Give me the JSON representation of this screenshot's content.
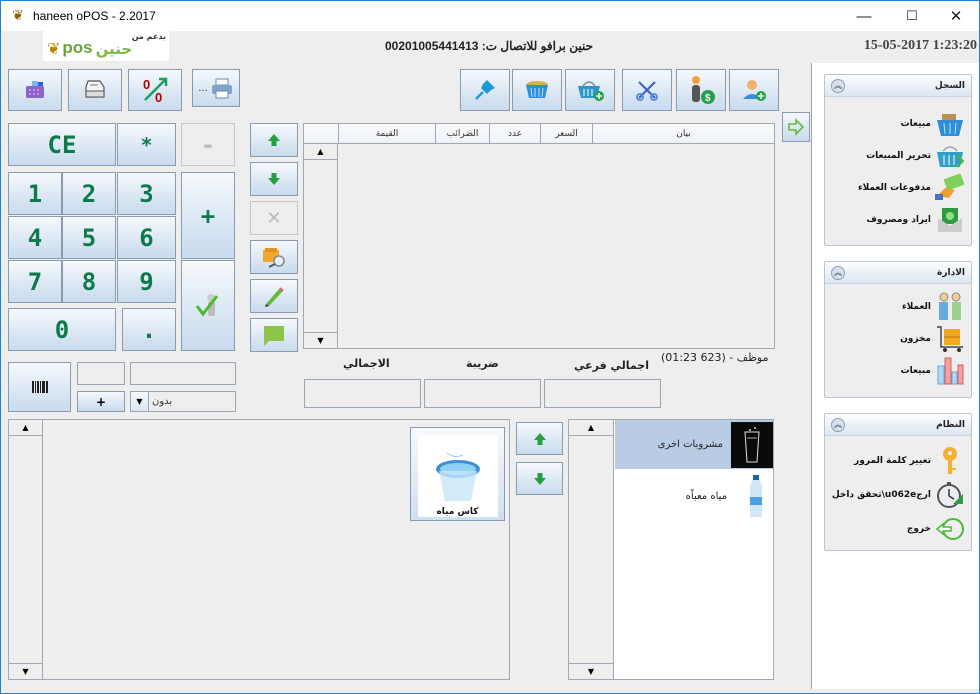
{
  "window": {
    "title": "haneen oPOS - 2.2017",
    "minimize": "—",
    "maximize": "☐",
    "close": "✕"
  },
  "header": {
    "logo_text_latin": "pos",
    "logo_text_arabic": "حنين",
    "logo_sup": "بدعم من",
    "contact": "حنين برافو للاتصال ت: 00201005441413",
    "datetime": "15-05-2017 1:23:20"
  },
  "toolbar_left": [
    {
      "name": "cash-drawer",
      "icon": "cash-register-icon"
    },
    {
      "name": "print-receipt",
      "icon": "printer-icon"
    },
    {
      "name": "discount",
      "icon": "percent-icon"
    },
    {
      "name": "printer-settings",
      "icon": "printer-dots-icon",
      "label": "..."
    }
  ],
  "toolbar_right": [
    {
      "name": "pin",
      "icon": "pin-icon"
    },
    {
      "name": "basket",
      "icon": "basket-icon"
    },
    {
      "name": "add-basket",
      "icon": "basket-add-icon"
    },
    {
      "name": "cut",
      "icon": "scissors-icon"
    },
    {
      "name": "customer-payment",
      "icon": "person-dollar-icon"
    },
    {
      "name": "add-customer",
      "icon": "user-add-icon"
    }
  ],
  "keypad": {
    "ce": "CE",
    "star": "*",
    "minus": "-",
    "plus": "+",
    "dot": ".",
    "zero": "0",
    "digits": [
      "1",
      "2",
      "3",
      "4",
      "5",
      "6",
      "7",
      "8",
      "9"
    ]
  },
  "side_tools": [
    {
      "name": "move-up",
      "icon": "arrow-up-icon"
    },
    {
      "name": "move-down",
      "icon": "arrow-down-icon"
    },
    {
      "name": "delete-line",
      "icon": "x-icon"
    },
    {
      "name": "search-product",
      "icon": "box-search-icon"
    },
    {
      "name": "edit-line",
      "icon": "pencil-icon"
    },
    {
      "name": "comment",
      "icon": "comment-icon"
    }
  ],
  "ticket_table": {
    "columns": [
      "بيان",
      "السعر",
      "عدد",
      "الضرائب",
      "القيمة"
    ],
    "rows": []
  },
  "employee_line": "موظف - (623 01:23)",
  "totals": {
    "subtotal_label": "اجمالي فرعي",
    "tax_label": "ضريبة",
    "total_label": "الاجمالي",
    "subtotal_value": "",
    "tax_value": "",
    "total_value": ""
  },
  "entry": {
    "plus_label": "+",
    "tax_select": "بدون"
  },
  "products": [
    {
      "name": "كاس مياه",
      "icon": "water-cup-icon"
    }
  ],
  "categories": [
    {
      "name": "مشروبات اخرى",
      "icon": "glass-splash-icon",
      "selected": true
    },
    {
      "name": "مياه معباًه",
      "icon": "water-bottle-icon",
      "selected": false
    }
  ],
  "sidebar": {
    "groups": [
      {
        "title": "السجل",
        "items": [
          {
            "label": "مبيعات",
            "icon": "shopping-basket-icon"
          },
          {
            "label": "تحرير المبيعات",
            "icon": "basket-edit-icon"
          },
          {
            "label": "مدفوعات العملاء",
            "icon": "money-hand-icon"
          },
          {
            "label": "ايراد ومصروف",
            "icon": "money-envelope-icon"
          }
        ]
      },
      {
        "title": "الادارة",
        "items": [
          {
            "label": "العملاء",
            "icon": "customers-icon"
          },
          {
            "label": "مخزون",
            "icon": "inventory-cart-icon"
          },
          {
            "label": "مبيعات",
            "icon": "bar-chart-icon"
          }
        ]
      },
      {
        "title": "النظام",
        "items": [
          {
            "label": "تغيير كلمة المرور",
            "icon": "key-icon"
          },
          {
            "label": "تحقق داخل\\u062eارج",
            "icon": "stopwatch-icon"
          },
          {
            "label": "خروج",
            "icon": "exit-icon"
          }
        ]
      }
    ]
  },
  "colors": {
    "accent_green": "#0e7a4a",
    "selected_row": "#b8cce4",
    "window_border": "#1883d7"
  }
}
